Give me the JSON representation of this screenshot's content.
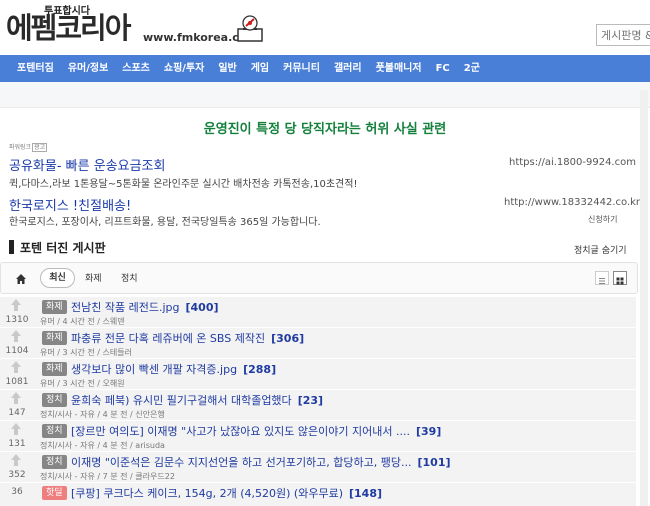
{
  "header": {
    "logo_small": "투표합시다",
    "logo_big": "에펨코리아",
    "url": "www.fmkorea.com",
    "search_placeholder": "게시판명 &"
  },
  "nav": {
    "items": [
      "포텐터짐",
      "유머/정보",
      "스포츠",
      "쇼핑/투자",
      "일반",
      "게임",
      "커뮤니티",
      "갤러리",
      "풋볼매니저",
      "FC",
      "2군"
    ]
  },
  "notice": "운영진이 특정 당 당직자라는 허위 사실 관련",
  "ads": {
    "label": "파워링크",
    "label_box": "광고",
    "items": [
      {
        "title": "공유화물- 빠른 운송요금조회",
        "url": "https://ai.1800-9924.com",
        "desc": "퀵,다마스,라보 1톤용달~5톤화물 온라인주문 실시간 배차전송 카톡전송,10초견적!"
      },
      {
        "title": "한국로지스 !친절배송!",
        "url": "http://www.18332442.co.kr",
        "desc": "한국로지스, 포장이사, 리프트화물, 용달, 전국당일특송 365일 가능합니다."
      }
    ],
    "apply_label": "신청하기"
  },
  "board": {
    "title": "포텐 터진 게시판",
    "hide_politics": "정치글 숨기기",
    "tabs": [
      "최신",
      "화제",
      "정치"
    ]
  },
  "posts": [
    {
      "votes": "1310",
      "category": "화제",
      "title": "전남친 작품 레전드.jpg",
      "comments": "[400]",
      "meta": "유머 / 4 시간 전 / 스웨덴",
      "hot": false
    },
    {
      "votes": "1104",
      "category": "화제",
      "title": "파충류 전문 다혹 레쥬버에 온 SBS 제작진",
      "comments": "[306]",
      "meta": "유머 / 3 시간 전 / 스테들러",
      "hot": false
    },
    {
      "votes": "1081",
      "category": "화제",
      "title": "생각보다 많이 빡센 개팔 자격증.jpg",
      "comments": "[288]",
      "meta": "유머 / 3 시간 전 / 오해원",
      "hot": false
    },
    {
      "votes": "147",
      "category": "정치",
      "title": "윤희숙 페북) 유시민 필기구걸해서 대학졸업했다",
      "comments": "[23]",
      "meta": "정치/시사 - 자유 / 4 분 전 / 신안은행",
      "hot": false
    },
    {
      "votes": "131",
      "category": "정치",
      "title": "[장르만 여의도] 이재명 \"사고가 났잖아요 있지도 않은이야기 지어내서 ....",
      "comments": "[39]",
      "meta": "정치/시사 - 자유 / 4 분 전 / arisuda",
      "hot": false
    },
    {
      "votes": "352",
      "category": "정치",
      "title": "이재명 \"이준석은 김문수 지지선언을 하고 선거포기하고, 합당하고, 팽당...",
      "comments": "[101]",
      "meta": "정치/시사 - 자유 / 7 분 전 / 클라우드22",
      "hot": false
    },
    {
      "votes": "36",
      "category": "핫딜",
      "title": "[쿠팡] 쿠크다스 케이크, 154g, 2개 (4,520원) (와우무료)",
      "comments": "[148]",
      "meta": "",
      "hot": true
    }
  ]
}
